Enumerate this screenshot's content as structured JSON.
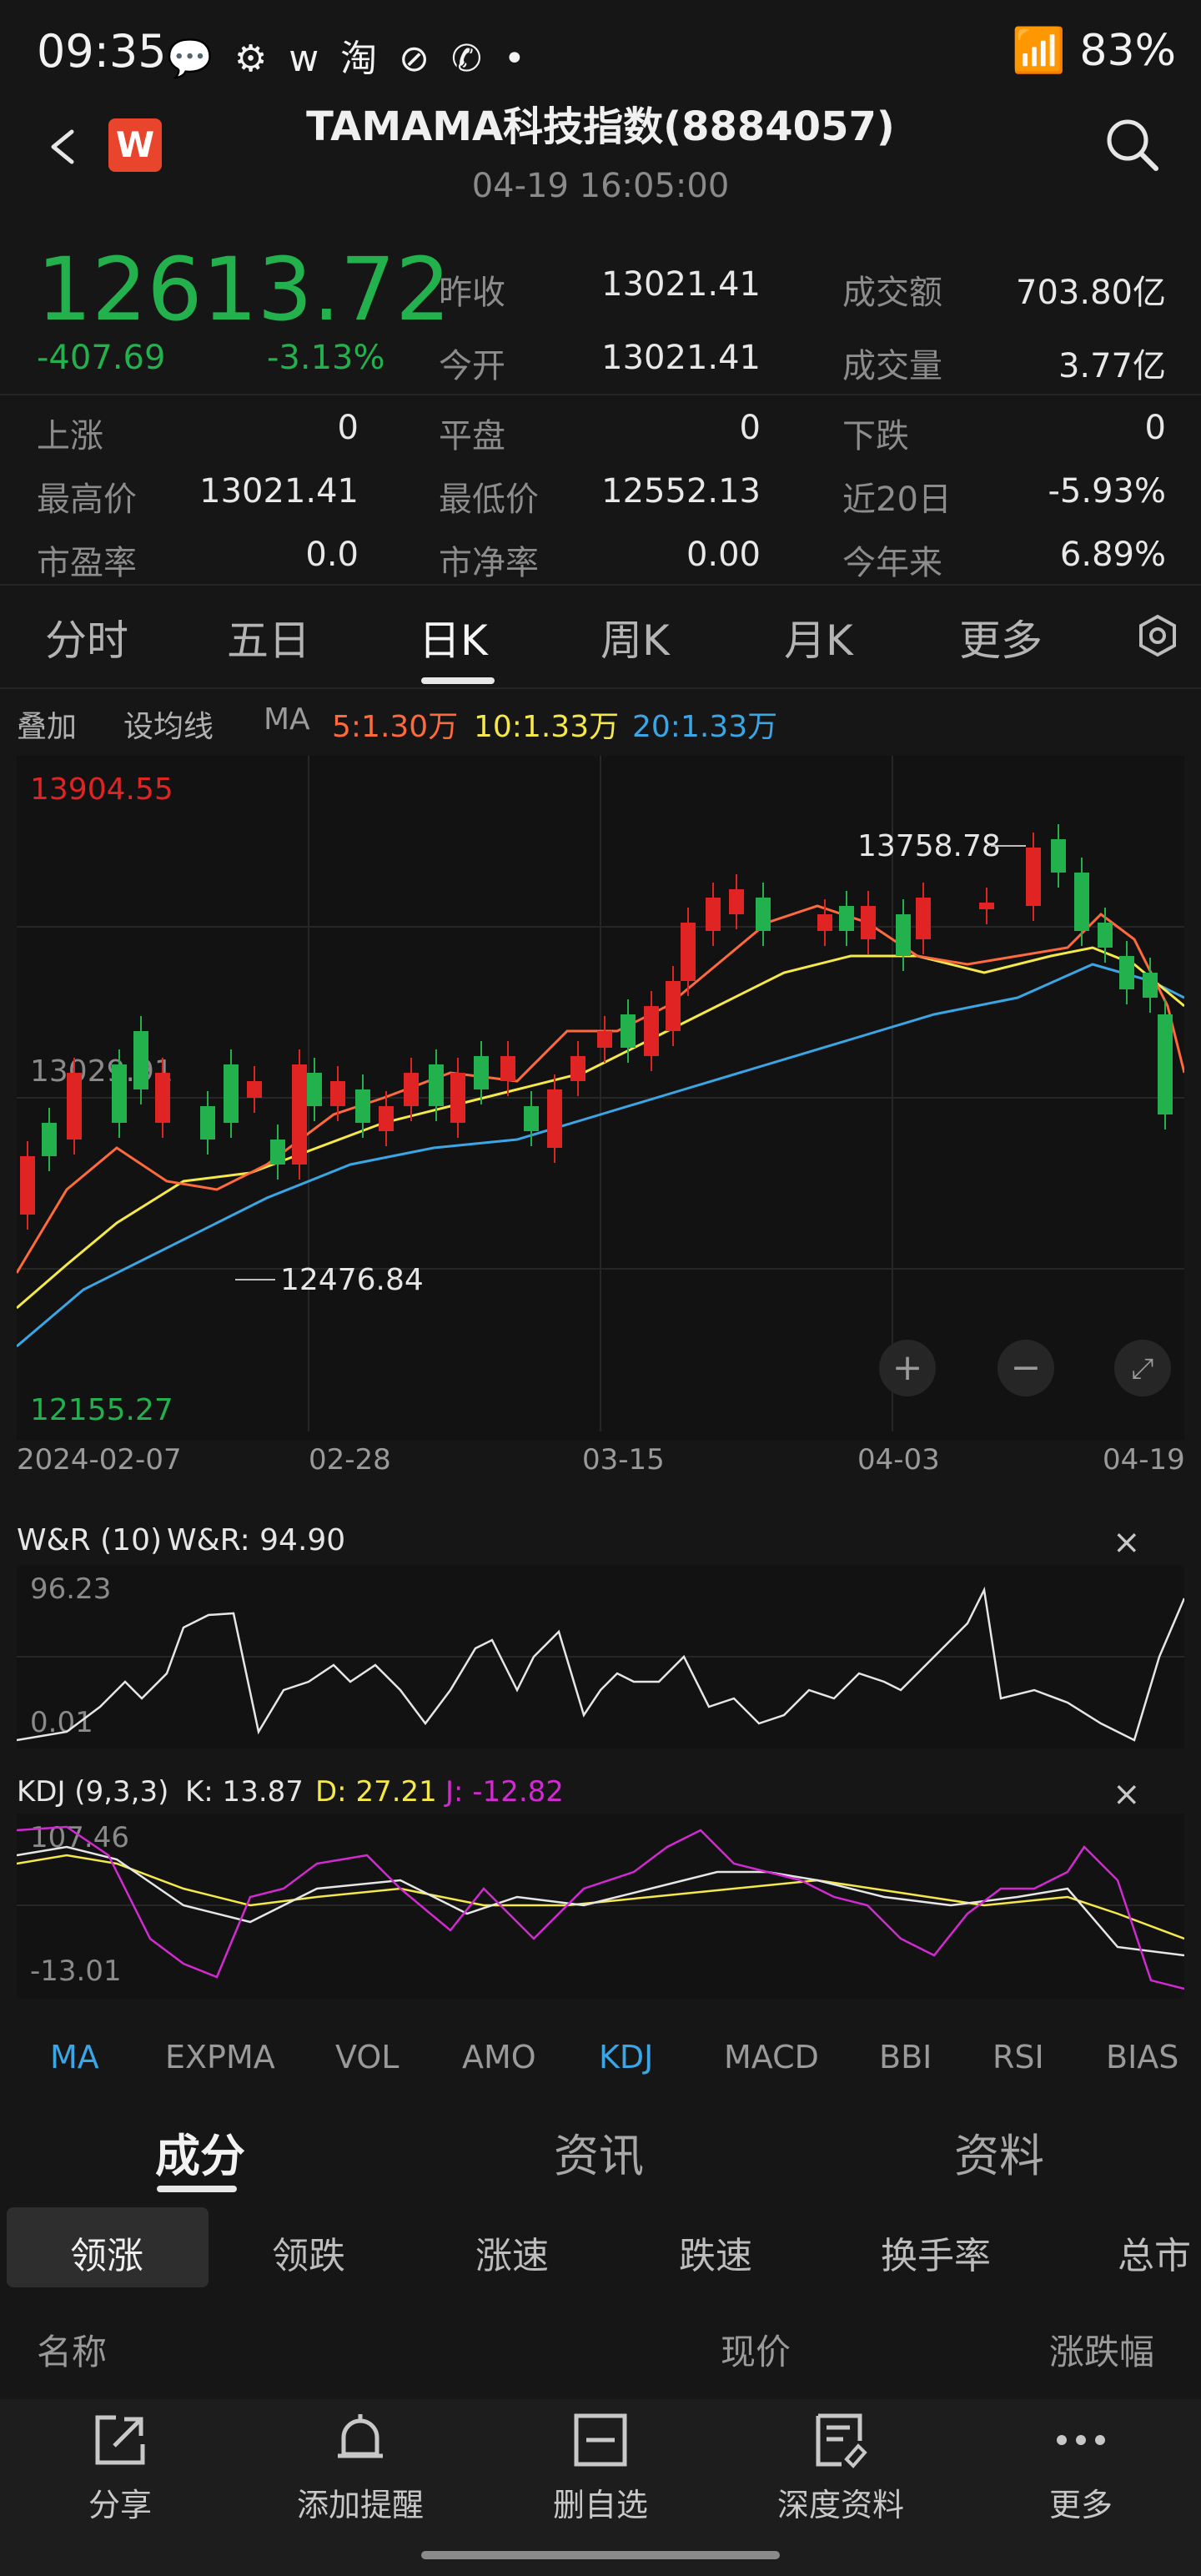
{
  "status_bar": {
    "time": "09:35",
    "icons_left": "💬 ⚙ w 淘 ⊘ ✆ •",
    "battery": "83%"
  },
  "header": {
    "title": "TAMAMA科技指数(8884057)",
    "datetime": "04-19 16:05:00",
    "brand_glyph": "W"
  },
  "quote": {
    "price": "12613.72",
    "change": "-407.69",
    "change_pct": "-3.13%",
    "stats": [
      {
        "label": "昨收",
        "value": "13021.41"
      },
      {
        "label": "成交额",
        "value": "703.80亿"
      },
      {
        "label": "今开",
        "value": "13021.41"
      },
      {
        "label": "成交量",
        "value": "3.77亿"
      },
      {
        "label": "上涨",
        "value": "0"
      },
      {
        "label": "平盘",
        "value": "0"
      },
      {
        "label": "下跌",
        "value": "0"
      },
      {
        "label": "最高价",
        "value": "13021.41"
      },
      {
        "label": "最低价",
        "value": "12552.13"
      },
      {
        "label": "近20日",
        "value": "-5.93%"
      },
      {
        "label": "市盈率",
        "value": "0.0"
      },
      {
        "label": "市净率",
        "value": "0.00"
      },
      {
        "label": "今年来",
        "value": "6.89%"
      }
    ]
  },
  "ktabs": [
    "分时",
    "五日",
    "日K",
    "周K",
    "月K",
    "更多"
  ],
  "ma_row": {
    "overlay": "叠加",
    "set_ma": "设均线",
    "ma": "MA",
    "ma5": "5:1.30万",
    "ma10": "10:1.33万",
    "ma20": "20:1.33万"
  },
  "chart_labels": {
    "y_top": "13904.55",
    "y_mid": "13029.91",
    "y_bot": "12155.27",
    "high_mark": "13758.78",
    "low_mark": "12476.84",
    "dates": [
      "2024-02-07",
      "02-28",
      "03-15",
      "04-03",
      "04-19"
    ]
  },
  "wr": {
    "title": "W&R (10)",
    "value": "W&R: 94.90",
    "top": "96.23",
    "bot": "0.01"
  },
  "kdj": {
    "title": "KDJ (9,3,3)",
    "k": "K: 13.87",
    "d": "D: 27.21",
    "j": "J: -12.82",
    "top": "107.46",
    "bot": "-13.01"
  },
  "indicator_tabs": [
    "MA",
    "EXPMA",
    "VOL",
    "AMO",
    "KDJ",
    "MACD",
    "BBI",
    "RSI",
    "BIAS"
  ],
  "section_tabs": [
    "成分",
    "资讯",
    "资料"
  ],
  "sub_tabs": [
    "领涨",
    "领跌",
    "涨速",
    "跌速",
    "换手率",
    "总市"
  ],
  "list_header": {
    "name": "名称",
    "price": "现价",
    "change": "涨跌幅"
  },
  "bottom_bar": [
    {
      "label": "分享",
      "icon": "share-icon"
    },
    {
      "label": "添加提醒",
      "icon": "bell-icon"
    },
    {
      "label": "删自选",
      "icon": "remove-watchlist-icon"
    },
    {
      "label": "深度资料",
      "icon": "report-icon"
    },
    {
      "label": "更多",
      "icon": "more-icon"
    }
  ],
  "colors": {
    "up": "#e02424",
    "down": "#22b14c",
    "ma5": "#ff6a3d",
    "ma10": "#f5e84a",
    "ma20": "#3ba6e6",
    "kdj_j": "#d12ad1"
  }
}
